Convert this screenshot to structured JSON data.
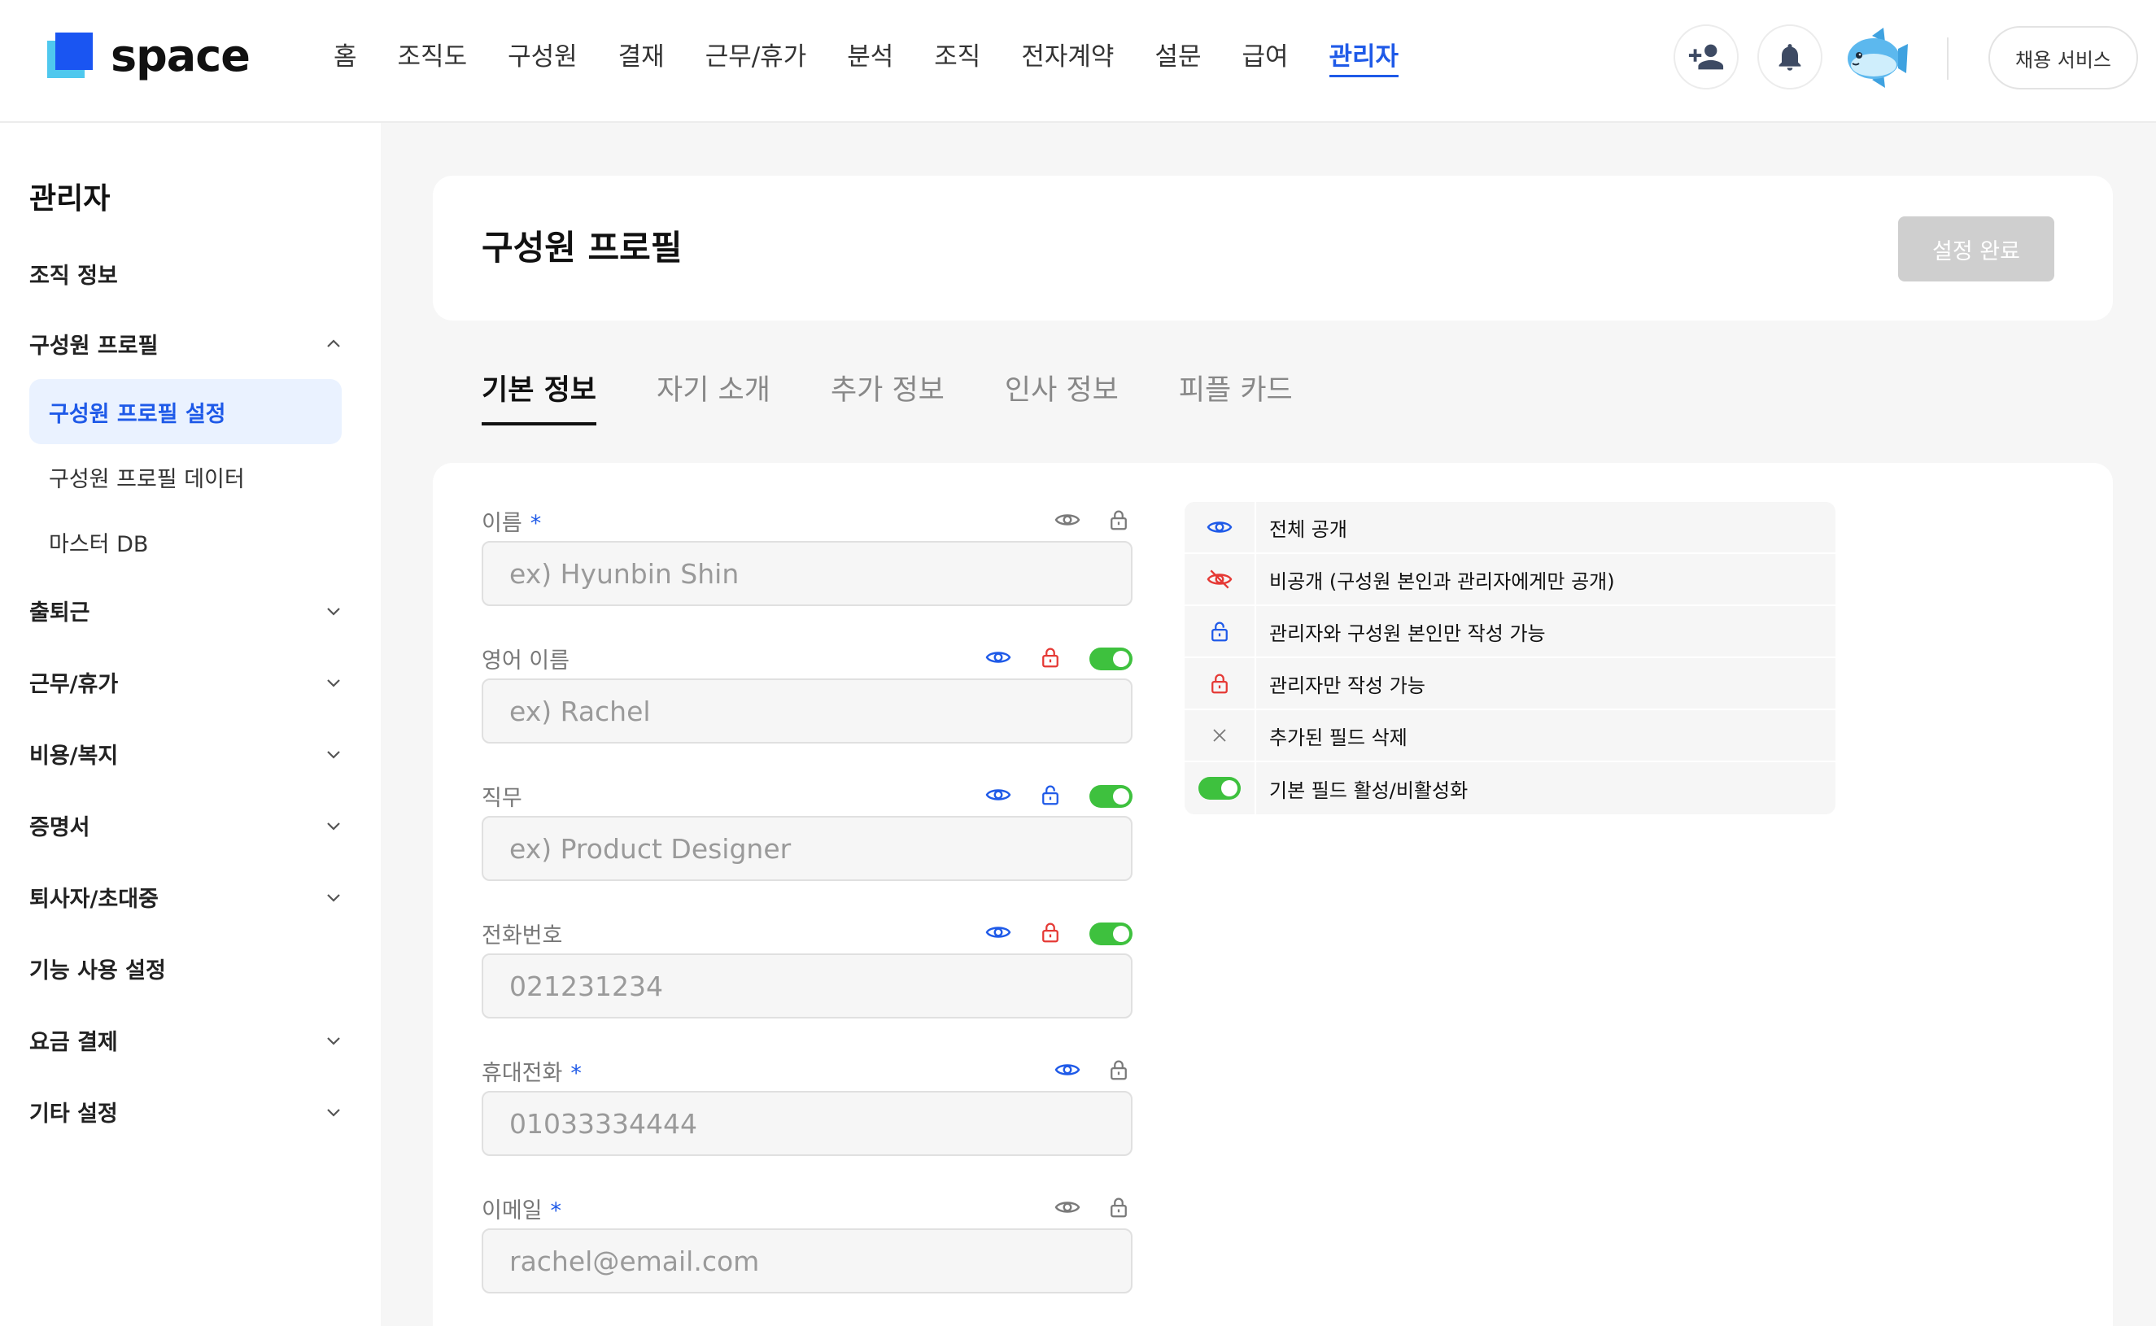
{
  "brand": {
    "name": "space"
  },
  "nav": {
    "items": [
      {
        "label": "홈"
      },
      {
        "label": "조직도"
      },
      {
        "label": "구성원"
      },
      {
        "label": "결재"
      },
      {
        "label": "근무/휴가"
      },
      {
        "label": "분석"
      },
      {
        "label": "조직"
      },
      {
        "label": "전자계약"
      },
      {
        "label": "설문"
      },
      {
        "label": "급여"
      },
      {
        "label": "관리자"
      }
    ],
    "active": "관리자"
  },
  "header_actions": {
    "recruit_label": "채용 서비스"
  },
  "sidebar": {
    "title": "관리자",
    "items": [
      {
        "label": "조직 정보"
      },
      {
        "label": "구성원 프로필",
        "expanded": true
      },
      {
        "label": "출퇴근"
      },
      {
        "label": "근무/휴가"
      },
      {
        "label": "비용/복지"
      },
      {
        "label": "증명서"
      },
      {
        "label": "퇴사자/초대중"
      },
      {
        "label": "기능 사용 설정"
      },
      {
        "label": "요금 결제"
      },
      {
        "label": "기타 설정"
      }
    ],
    "sub_items": [
      {
        "label": "구성원 프로필 설정",
        "active": true
      },
      {
        "label": "구성원 프로필 데이터"
      },
      {
        "label": "마스터 DB"
      }
    ]
  },
  "page": {
    "title": "구성원 프로필",
    "done_label": "설정 완료"
  },
  "tabs": [
    {
      "label": "기본 정보",
      "active": true
    },
    {
      "label": "자기 소개"
    },
    {
      "label": "추가 정보"
    },
    {
      "label": "인사 정보"
    },
    {
      "label": "피플 카드"
    }
  ],
  "fields": [
    {
      "label": "이름",
      "required": "*",
      "placeholder": "ex) Hyunbin Shin",
      "visibility": "public",
      "lock": "default",
      "toggle": false
    },
    {
      "label": "영어 이름",
      "required": "",
      "placeholder": "ex) Rachel",
      "visibility": "public",
      "lock": "admin-only",
      "toggle": true
    },
    {
      "label": "직무",
      "required": "",
      "placeholder": "ex) Product Designer",
      "visibility": "public",
      "lock": "admin-and-self",
      "toggle": true
    },
    {
      "label": "전화번호",
      "required": "",
      "placeholder": "021231234",
      "visibility": "public",
      "lock": "admin-only",
      "toggle": true
    },
    {
      "label": "휴대전화",
      "required": "*",
      "placeholder": "01033334444",
      "visibility": "public",
      "lock": "default",
      "toggle": false
    },
    {
      "label": "이메일",
      "required": "*",
      "placeholder": "rachel@email.com",
      "visibility": "public",
      "lock": "default",
      "toggle": false
    }
  ],
  "legend": [
    {
      "icon": "eye-icon",
      "text": "전체 공개"
    },
    {
      "icon": "eye-off-icon",
      "text": "비공개 (구성원 본인과 관리자에게만 공개)"
    },
    {
      "icon": "lock-open-icon",
      "text": "관리자와 구성원 본인만 작성 가능"
    },
    {
      "icon": "lock-icon",
      "text": "관리자만 작성 가능"
    },
    {
      "icon": "close-icon",
      "text": "추가된 필드 삭제"
    },
    {
      "icon": "toggle-icon",
      "text": "기본 필드 활성/비활성화"
    }
  ],
  "colors": {
    "accent": "#1f5ae8",
    "danger": "#e53935",
    "toggle_on": "#3ec13e",
    "disabled_button": "#cfcfcf"
  }
}
